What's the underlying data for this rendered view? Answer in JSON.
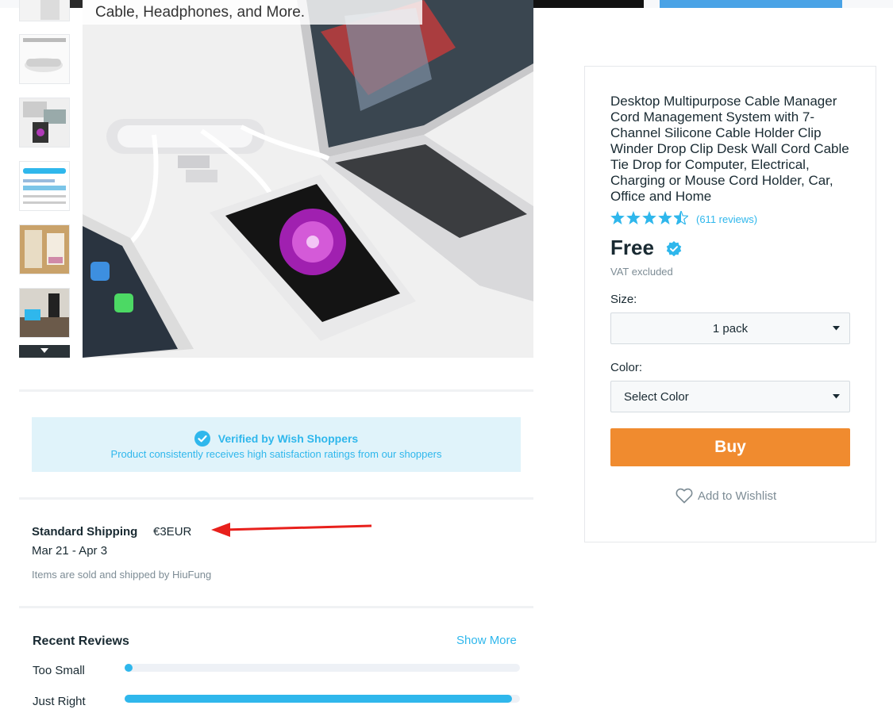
{
  "gallery": {
    "caption": "Cable, Headphones, and More.",
    "more_icon": "chevron-down-icon"
  },
  "verified": {
    "icon": "check-badge-icon",
    "title": "Verified by Wish Shoppers",
    "subtitle": "Product consistently receives high satisfaction ratings from our shoppers"
  },
  "shipping": {
    "title": "Standard Shipping",
    "price": "€3EUR",
    "dates": "Mar 21 - Apr 3",
    "seller": "Items are sold and shipped by HiuFung"
  },
  "reviews": {
    "title": "Recent Reviews",
    "show_more": "Show More",
    "fit": [
      {
        "label": "Too Small",
        "fraction": 0.02
      },
      {
        "label": "Just Right",
        "fraction": 0.98
      }
    ]
  },
  "product": {
    "title": "Desktop Multipurpose Cable Manager Cord Management System with 7-Channel Silicone Cable Holder Clip Winder Drop Clip Desk Wall Cord Cable Tie Drop for Computer, Electrical, Charging or Mouse Cord Holder, Car, Office and Home",
    "rating": 4.5,
    "reviews_text": "(611 reviews)",
    "price": "Free",
    "vat": "VAT excluded",
    "size_label": "Size:",
    "size_value": "1 pack",
    "color_label": "Color:",
    "color_value": "Select Color",
    "buy_label": "Buy",
    "wishlist_label": "Add to Wishlist"
  },
  "colors": {
    "accent": "#2fb7ec",
    "buy": "#f08b2f",
    "text": "#192a32",
    "muted": "#7d8c95",
    "annotation_arrow": "#e8201c"
  }
}
